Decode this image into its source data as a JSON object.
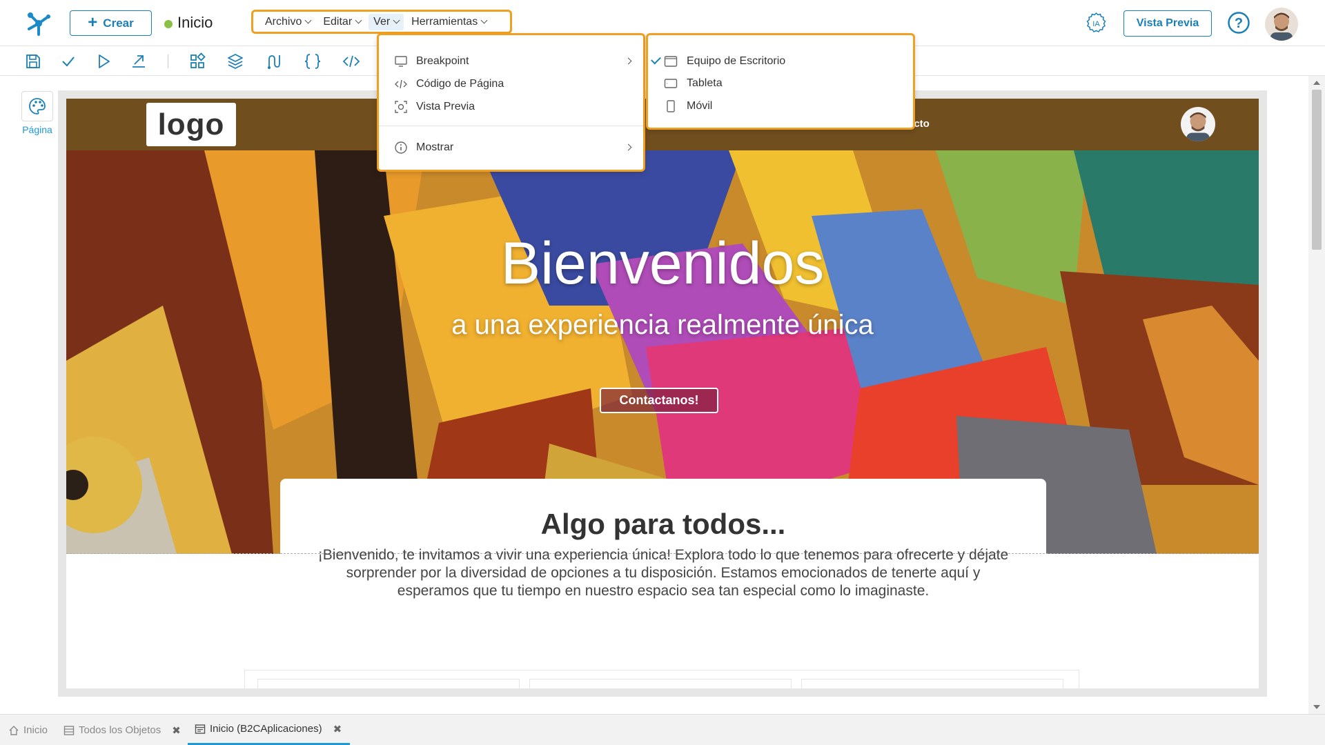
{
  "header": {
    "create_label": "Crear",
    "page_name": "Inicio",
    "preview_label": "Vista Previa",
    "ia_label": "IA",
    "help_label": "?"
  },
  "menu": {
    "items": [
      {
        "label": "Archivo"
      },
      {
        "label": "Editar"
      },
      {
        "label": "Ver"
      },
      {
        "label": "Herramientas"
      }
    ]
  },
  "ver_menu": {
    "items": [
      {
        "label": "Breakpoint",
        "icon": "monitor-icon"
      },
      {
        "label": "Código de Página",
        "icon": "code-icon"
      },
      {
        "label": "Vista Previa",
        "icon": "preview-icon"
      },
      {
        "label": "Mostrar",
        "icon": "info-icon"
      }
    ]
  },
  "breakpoint_menu": {
    "items": [
      {
        "label": "Equipo de Escritorio",
        "checked": true
      },
      {
        "label": "Tableta",
        "checked": false
      },
      {
        "label": "Móvil",
        "checked": false
      }
    ]
  },
  "sidebar": {
    "page_label": "Página"
  },
  "site": {
    "logo": "logo",
    "nav_link": "acto",
    "hero_title": "Bienvenidos",
    "hero_subtitle": "a una experiencia realmente única",
    "hero_button": "Contactanos!",
    "card_title": "Algo para todos...",
    "card_text": "¡Bienvenido, te invitamos a vivir una experiencia única! Explora todo lo que tenemos para ofrecerte y déjate sorprender por la diversidad de opciones a tu disposición. Estamos emocionados de tenerte aquí y esperamos que tu tiempo en nuestro espacio sea tan especial como lo imaginaste."
  },
  "bottom_tabs": [
    {
      "label": "Inicio"
    },
    {
      "label": "Todos los Objetos"
    },
    {
      "label": "Inicio (B2CAplicaciones)"
    }
  ],
  "colors": {
    "accent": "#1a7fb8",
    "highlight": "#f0a020",
    "status_green": "#8ac044"
  }
}
